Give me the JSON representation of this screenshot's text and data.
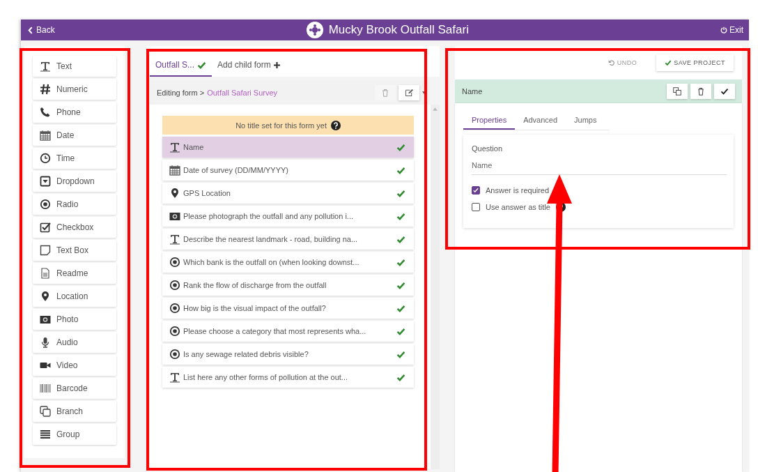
{
  "header": {
    "back": "Back",
    "title": "Mucky Brook Outfall Safari",
    "exit": "Exit"
  },
  "palette": [
    {
      "kind": "text",
      "label": "Text"
    },
    {
      "kind": "numeric",
      "label": "Numeric"
    },
    {
      "kind": "phone",
      "label": "Phone"
    },
    {
      "kind": "date",
      "label": "Date"
    },
    {
      "kind": "time",
      "label": "Time"
    },
    {
      "kind": "dropdown",
      "label": "Dropdown"
    },
    {
      "kind": "radio",
      "label": "Radio"
    },
    {
      "kind": "checkbox",
      "label": "Checkbox"
    },
    {
      "kind": "textbox",
      "label": "Text Box"
    },
    {
      "kind": "readme",
      "label": "Readme"
    },
    {
      "kind": "location",
      "label": "Location"
    },
    {
      "kind": "photo",
      "label": "Photo"
    },
    {
      "kind": "audio",
      "label": "Audio"
    },
    {
      "kind": "video",
      "label": "Video"
    },
    {
      "kind": "barcode",
      "label": "Barcode"
    },
    {
      "kind": "branch",
      "label": "Branch"
    },
    {
      "kind": "group",
      "label": "Group"
    }
  ],
  "form_tabs": [
    {
      "kind": "form",
      "label": "Outfall S...",
      "selected": true,
      "valid": true
    },
    {
      "kind": "add",
      "label": "Add child form",
      "selected": false,
      "valid": false
    }
  ],
  "breadcrumb": {
    "prefix": "Editing form >",
    "form": "Outfall Safari Survey"
  },
  "title_notice": "No title set for this form yet",
  "questions": [
    {
      "kind": "text",
      "text": "Name",
      "selected": true,
      "valid": true
    },
    {
      "kind": "date",
      "text": "Date of survey (DD/MM/YYYY)",
      "selected": false,
      "valid": true
    },
    {
      "kind": "location",
      "text": "GPS Location",
      "selected": false,
      "valid": true
    },
    {
      "kind": "photo",
      "text": "Please photograph the outfall and any pollution i...",
      "selected": false,
      "valid": true
    },
    {
      "kind": "text",
      "text": "Describe the nearest landmark - road, building na...",
      "selected": false,
      "valid": true
    },
    {
      "kind": "radio",
      "text": "Which bank is the outfall on (when looking downst...",
      "selected": false,
      "valid": true
    },
    {
      "kind": "radio",
      "text": "Rank the flow of discharge from the outfall",
      "selected": false,
      "valid": true
    },
    {
      "kind": "radio",
      "text": "How big is the visual impact of the outfall?",
      "selected": false,
      "valid": true
    },
    {
      "kind": "radio",
      "text": "Please choose a category that most represents wha...",
      "selected": false,
      "valid": true
    },
    {
      "kind": "radio",
      "text": "Is any sewage related debris visible?",
      "selected": false,
      "valid": true
    },
    {
      "kind": "text",
      "text": "List here any other forms of pollution at the out...",
      "selected": false,
      "valid": true
    }
  ],
  "toolbar": {
    "undo": {
      "label": "UNDO",
      "disabled": true
    },
    "save": "SAVE PROJECT"
  },
  "question_panel": {
    "title": "Name",
    "tabs": [
      {
        "label": "Properties",
        "selected": true
      },
      {
        "label": "Advanced",
        "selected": false
      },
      {
        "label": "Jumps",
        "selected": false
      }
    ],
    "field_label": "Question",
    "field_value": "Name",
    "options": [
      {
        "label": "Answer is required",
        "checked": true,
        "help": false
      },
      {
        "label": "Use answer as title",
        "checked": false,
        "help": true
      }
    ]
  }
}
